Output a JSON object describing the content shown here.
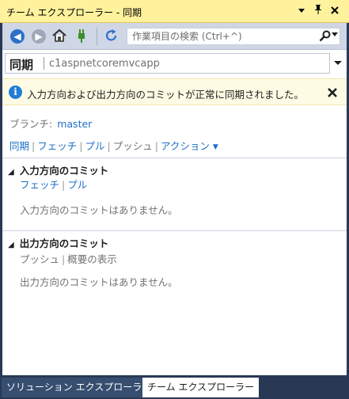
{
  "window": {
    "title": "チーム エクスプローラー - 同期",
    "buttons": [
      "▾",
      "⊥",
      "✕"
    ]
  },
  "toolbar": {
    "search_placeholder": "作業項目の検索 (Ctrl+^)"
  },
  "page": {
    "name": "同期",
    "repo": "c1aspnetcoremvcapp"
  },
  "info": {
    "message": "入力方向および出力方向のコミットが正常に同期されました。"
  },
  "branch": {
    "label": "ブランチ:",
    "value": "master"
  },
  "actions": {
    "sync": "同期",
    "fetch": "フェッチ",
    "pull": "プル",
    "push": "プッシュ",
    "action": "アクション"
  },
  "incoming": {
    "title": "入力方向のコミット",
    "fetch": "フェッチ",
    "pull": "プル",
    "empty": "入力方向のコミットはありません。"
  },
  "outgoing": {
    "title": "出力方向のコミット",
    "push": "プッシュ",
    "summary": "概要の表示",
    "empty": "出力方向のコミットはありません。"
  },
  "tabs": {
    "solution": "ソリューション エクスプローラー",
    "team": "チーム エクスプローラー"
  },
  "colors": {
    "title_bg": "#fff29d",
    "frame_bg": "#293955",
    "link": "#1e6fc9",
    "info_bg": "#fdfbe3"
  }
}
